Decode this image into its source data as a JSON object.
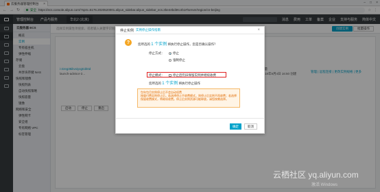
{
  "browser": {
    "tab_title": "云服务器管理控制台",
    "secure_label": "安全",
    "url": "https://ecs.console.aliyun.com/?spm=5176.2020520001.aliyun_sidebar.aliyun_sidebar_ecs.2be44bd3Korb1#/server/region/cn-beijing"
  },
  "topnav": {
    "console_label": "管理控制台",
    "product_label": "产品与服务",
    "region_label": "华北2 (北京)",
    "right_items": [
      "消息",
      "费用",
      "工单",
      "备案",
      "企业",
      "支持与服务",
      "简体中文"
    ]
  },
  "sidebar2": {
    "title": "云服务器 ECS",
    "items": [
      {
        "label": "概览",
        "group": false,
        "active": false
      },
      {
        "label": "实例",
        "group": false,
        "active": true
      },
      {
        "label": "专有宿主机",
        "group": false,
        "active": false
      },
      {
        "label": "弹性伸缩",
        "group": false,
        "active": false
      },
      {
        "label": "存储",
        "group": true,
        "active": false
      },
      {
        "label": "云盘",
        "group": false,
        "active": false
      },
      {
        "label": "共享块存储 NAS",
        "group": false,
        "active": false
      },
      {
        "label": "快照和镜像",
        "group": true,
        "active": false
      },
      {
        "label": "快照列表",
        "group": false,
        "active": false
      },
      {
        "label": "自动快照策略",
        "group": false,
        "active": false
      },
      {
        "label": "快照容量",
        "group": false,
        "active": false
      },
      {
        "label": "镜像",
        "group": false,
        "active": false
      },
      {
        "label": "网络和安全",
        "group": true,
        "active": false
      },
      {
        "label": "弹性网卡",
        "group": false,
        "active": false
      },
      {
        "label": "安全组",
        "group": false,
        "active": false
      },
      {
        "label": "专有网络 VPC",
        "group": false,
        "active": false
      },
      {
        "label": "标签管理",
        "group": false,
        "active": false
      }
    ]
  },
  "main": {
    "search_placeholder": "选择实例属性项搜索，或者输入关键字识别搜索",
    "tag_button": "标签",
    "instance_id": "i-2zeg35ikvxiyxgt1bktd",
    "instance_name": "launch-advisor-2...",
    "billing_text": "按量",
    "created_text": "2018年9月4日 16:50 创建",
    "actions_text": "管理 | 远程连接 | 更改实例规格 | 更多",
    "footer_buttons": [
      "启动",
      "停止",
      "重启"
    ],
    "create_button": "创建实例",
    "batch_button": "批量操作"
  },
  "modal": {
    "title": "停止实例",
    "help_link": "实例停止操作指南",
    "selected_prefix": "您所选的",
    "selected_count": "1 个实例",
    "selected_suffix": "将执行停止操作，您是否确认操作？",
    "stop_mode_label": "停止方式：",
    "stop_options": [
      "停止",
      "强制停止"
    ],
    "stop_mode_row_label": "停止模式：",
    "keep_billing_label": "停止后仍旧保留实例并继续收费",
    "summary_prefix": "您所选的",
    "summary_count": "1 个实例",
    "summary_suffix": "将执行停止操作",
    "tip_title": "包年包月实例停止后不会自动续费",
    "tip_body": "按量付费实例停止后，若选择停止不收费模式，则停止后实例不再收费；若选择保留收费模式，将继续收费。停止后实例资源可能释放，请您按需选择。",
    "ok_label": "确定",
    "cancel_label": "取消"
  },
  "watermark": "云栖社区 yq.aliyun.com",
  "os_watermark": "激活 Windows",
  "colors": {
    "accent": "#00a2ca",
    "nav_dark": "#373d41",
    "warning": "#f5a623",
    "highlight_border": "#e02020"
  }
}
